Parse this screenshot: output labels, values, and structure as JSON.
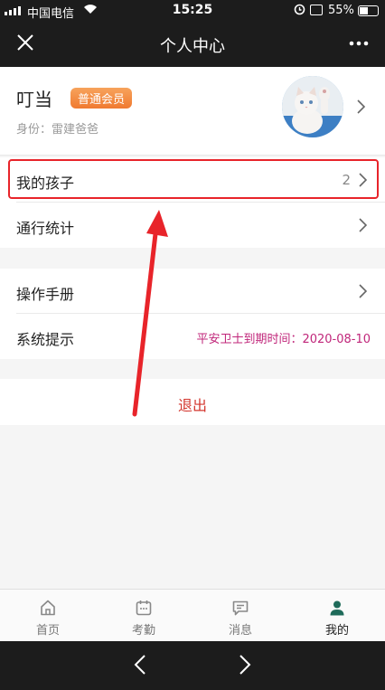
{
  "status_bar": {
    "carrier": "中国电信",
    "time": "15:25",
    "battery": "55%",
    "battery_level": 0.55
  },
  "header": {
    "title": "个人中心"
  },
  "profile": {
    "name": "叮当",
    "badge": "普通会员",
    "identity": "身份：雷建爸爸"
  },
  "menu": {
    "my_children": {
      "label": "我的孩子",
      "value": "2"
    },
    "traffic_stats": {
      "label": "通行统计"
    },
    "manual": {
      "label": "操作手册"
    },
    "system_notice": {
      "label": "系统提示",
      "value": "平安卫士到期时间：2020-08-10"
    }
  },
  "logout": {
    "label": "退出"
  },
  "tabs": [
    {
      "label": "首页",
      "icon": "home-icon"
    },
    {
      "label": "考勤",
      "icon": "calendar-icon"
    },
    {
      "label": "消息",
      "icon": "message-icon"
    },
    {
      "label": "我的",
      "icon": "person-icon"
    }
  ],
  "colors": {
    "accent_green": "#1f6b5a",
    "highlight_red": "#e8242a",
    "badge_orange": "#f08a3c",
    "notice_pink": "#c0267a"
  }
}
